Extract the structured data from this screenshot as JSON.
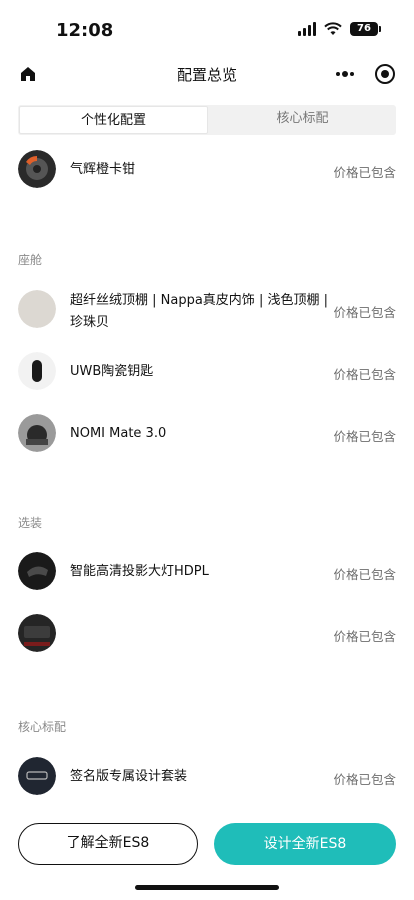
{
  "status": {
    "time": "12:08",
    "battery": "76"
  },
  "nav": {
    "title": "配置总览"
  },
  "tabs": [
    {
      "label": "个性化配置",
      "active": true
    },
    {
      "label": "核心标配",
      "active": false
    }
  ],
  "top_item": {
    "name": "气辉橙卡钳",
    "price": "价格已包含"
  },
  "sections": [
    {
      "title": "座舱",
      "items": [
        {
          "name": "超纤丝绒顶棚 | Nappa真皮内饰 | 浅色顶棚 | 珍珠贝",
          "price": "价格已包含"
        },
        {
          "name": "UWB陶瓷钥匙",
          "price": "价格已包含"
        },
        {
          "name": "NOMI Mate 3.0",
          "price": "价格已包含"
        }
      ]
    },
    {
      "title": "选装",
      "items": [
        {
          "name": "智能高清投影大灯HDPL",
          "price": "价格已包含"
        },
        {
          "name": "",
          "price": "价格已包含"
        }
      ]
    },
    {
      "title": "核心标配",
      "items": [
        {
          "name": "签名版专属设计套装",
          "price": "价格已包含"
        }
      ]
    }
  ],
  "buttons": {
    "learn": "了解全新ES8",
    "design": "设计全新ES8"
  },
  "colors": {
    "accent": "#1fbdb9",
    "text": "#111111",
    "muted": "#8a8a8a"
  }
}
